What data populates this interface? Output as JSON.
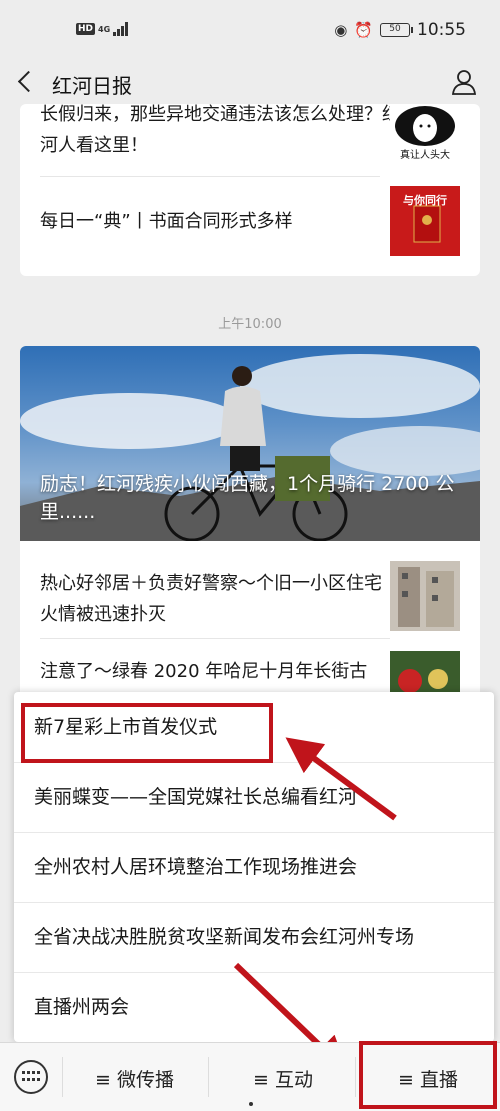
{
  "status_bar": {
    "network_badge": "HD",
    "signal_label": "4G",
    "battery": "50",
    "time": "10:55"
  },
  "header": {
    "title": "红河日报"
  },
  "feed1": {
    "items": [
      {
        "title": "长假归来，那些异地交通违法该怎么处理？红河人看这里！",
        "thumb_caption": "真让人头大"
      },
      {
        "title": "每日一“典”丨书面合同形式多样",
        "thumb_caption": "与你同行"
      }
    ]
  },
  "time_label": "上午10:00",
  "feed2": {
    "hero_title": "励志！红河残疾小伙闯西藏，1个月骑行 2700 公里......",
    "items": [
      {
        "title": "热心好邻居＋负责好警察～个旧一小区住宅火情被迅速扑灭"
      },
      {
        "title": "注意了～绿春 2020 年哈尼十月年长街古"
      }
    ]
  },
  "popup_menu": {
    "items": [
      "新7星彩上市首发仪式",
      "美丽蝶变——全国党媒社长总编看红河",
      "全州农村人居环境整治工作现场推进会",
      "全省决战决胜脱贫攻坚新闻发布会红河州专场",
      "直播州两会"
    ]
  },
  "tab_bar": {
    "tabs": [
      "≡ 微传播",
      "≡ 互动",
      "≡ 直播"
    ]
  },
  "colors": {
    "annotation": "#c0141b",
    "background": "#ededed"
  }
}
